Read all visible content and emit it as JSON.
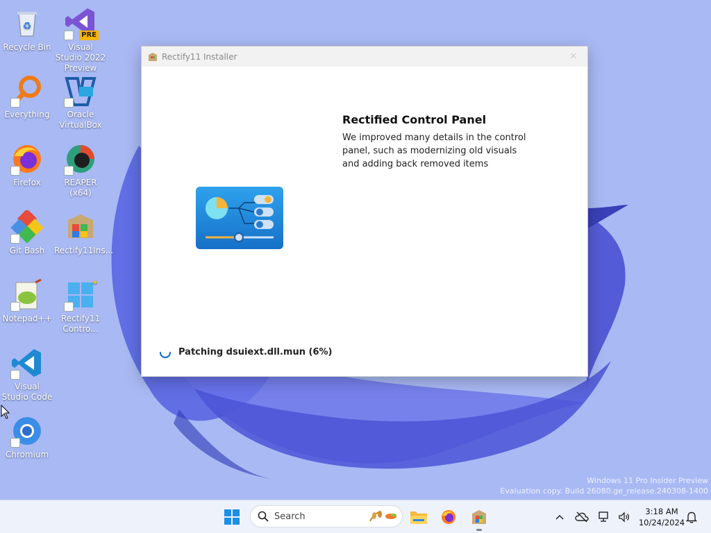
{
  "desktop": {
    "icons": [
      {
        "label": "Recycle Bin",
        "icon": "recycle-bin-icon"
      },
      {
        "label": "Visual Studio 2022 Preview",
        "icon": "visual-studio-icon",
        "badge": "PRE"
      },
      {
        "label": "Everything",
        "icon": "everything-search-icon"
      },
      {
        "label": "Oracle VirtualBox",
        "icon": "virtualbox-icon"
      },
      {
        "label": "Firefox",
        "icon": "firefox-icon"
      },
      {
        "label": "REAPER (x64)",
        "icon": "reaper-icon"
      },
      {
        "label": "Git Bash",
        "icon": "git-bash-icon"
      },
      {
        "label": "Rectify11Ins...",
        "icon": "rectify11-installer-icon"
      },
      {
        "label": "Notepad++",
        "icon": "notepad-plus-plus-icon"
      },
      {
        "label": "Rectify11 Contro...",
        "icon": "rectify11-control-icon"
      },
      {
        "label": "Visual Studio Code",
        "icon": "vscode-icon"
      },
      {
        "label": "Chromium",
        "icon": "chromium-icon"
      }
    ]
  },
  "installer": {
    "title": "Rectify11 Installer",
    "close_glyph": "✕",
    "heading": "Rectified Control Panel",
    "description": "We improved many details in the control panel, such as modernizing old visuals and adding back removed items",
    "status": "Patching dsuiext.dll.mun (6%)",
    "progress_percent": 6
  },
  "watermark": {
    "line1": "Windows 11 Pro Insider Preview",
    "line2": "Evaluation copy. Build 26080.ge_release.240308-1400"
  },
  "taskbar": {
    "search_placeholder": "Search",
    "pinned": [
      "start-icon",
      "file-explorer-icon",
      "firefox-icon",
      "rectify11-installer-icon"
    ],
    "clock_time": "3:18 AM",
    "clock_date": "10/24/2024"
  },
  "colors": {
    "desktop_bg": "#a9b9f4",
    "accent": "#0067c0",
    "taskbar_bg": "#eef2fb"
  }
}
